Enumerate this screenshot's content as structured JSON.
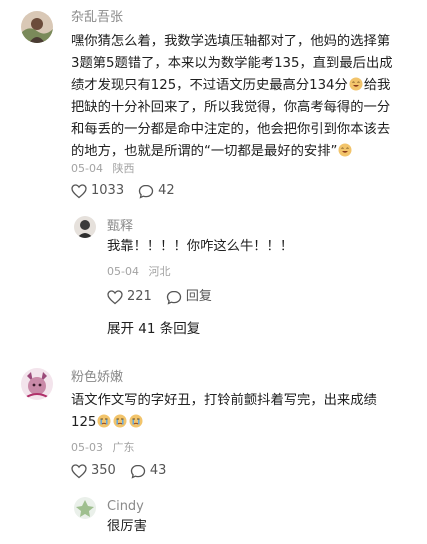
{
  "comments": [
    {
      "username": "杂乱吾张",
      "lines": [
        "嘿你猜怎么着，我数学选填压轴都对了，他妈的选择第",
        "3题第5题错了，本来以为数学能考135，直到最后出成",
        "绩才发现只有125，不过语文历史最高分134分",
        "把缺的十分补回来了，所以我觉得，你高考每得的一分",
        "和每丢的一分都是命中注定的，他会把你引到你本该去",
        "的地方，也就是所谓的“一切都是最好的安排”"
      ],
      "line3_tail": "给我",
      "date": "05-04",
      "location": "陕西",
      "likes": "1033",
      "comments_count": "42",
      "reply": {
        "username": "甄释",
        "text": "我靠！！！！你咋这么牛！！！",
        "date": "05-04",
        "location": "河北",
        "likes": "221",
        "reply_label": "回复"
      },
      "expand_label": "展开 41 条回复"
    },
    {
      "username": "粉色娇嫩",
      "lines": [
        "语文作文写的字好丑，打铃前颤抖着写完，出来成绩",
        "125"
      ],
      "date": "05-03",
      "location": "广东",
      "likes": "350",
      "comments_count": "43",
      "reply": {
        "username": "Cindy",
        "text": "很厉害"
      }
    }
  ],
  "icons": [
    "heart-icon",
    "comment-icon",
    "emoji-laugh-icon",
    "emoji-cry-icon"
  ],
  "colors": {
    "username": "#8a8a8a",
    "meta": "#a3a3a3",
    "text": "#202020"
  }
}
